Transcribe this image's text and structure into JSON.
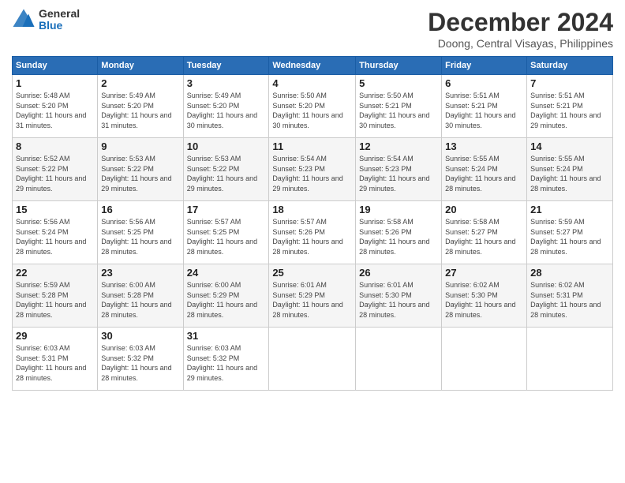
{
  "logo": {
    "general": "General",
    "blue": "Blue"
  },
  "title": "December 2024",
  "subtitle": "Doong, Central Visayas, Philippines",
  "days_header": [
    "Sunday",
    "Monday",
    "Tuesday",
    "Wednesday",
    "Thursday",
    "Friday",
    "Saturday"
  ],
  "weeks": [
    [
      {
        "day": "1",
        "sunrise": "5:48 AM",
        "sunset": "5:20 PM",
        "daylight": "11 hours and 31 minutes."
      },
      {
        "day": "2",
        "sunrise": "5:49 AM",
        "sunset": "5:20 PM",
        "daylight": "11 hours and 31 minutes."
      },
      {
        "day": "3",
        "sunrise": "5:49 AM",
        "sunset": "5:20 PM",
        "daylight": "11 hours and 30 minutes."
      },
      {
        "day": "4",
        "sunrise": "5:50 AM",
        "sunset": "5:20 PM",
        "daylight": "11 hours and 30 minutes."
      },
      {
        "day": "5",
        "sunrise": "5:50 AM",
        "sunset": "5:21 PM",
        "daylight": "11 hours and 30 minutes."
      },
      {
        "day": "6",
        "sunrise": "5:51 AM",
        "sunset": "5:21 PM",
        "daylight": "11 hours and 30 minutes."
      },
      {
        "day": "7",
        "sunrise": "5:51 AM",
        "sunset": "5:21 PM",
        "daylight": "11 hours and 29 minutes."
      }
    ],
    [
      {
        "day": "8",
        "sunrise": "5:52 AM",
        "sunset": "5:22 PM",
        "daylight": "11 hours and 29 minutes."
      },
      {
        "day": "9",
        "sunrise": "5:53 AM",
        "sunset": "5:22 PM",
        "daylight": "11 hours and 29 minutes."
      },
      {
        "day": "10",
        "sunrise": "5:53 AM",
        "sunset": "5:22 PM",
        "daylight": "11 hours and 29 minutes."
      },
      {
        "day": "11",
        "sunrise": "5:54 AM",
        "sunset": "5:23 PM",
        "daylight": "11 hours and 29 minutes."
      },
      {
        "day": "12",
        "sunrise": "5:54 AM",
        "sunset": "5:23 PM",
        "daylight": "11 hours and 29 minutes."
      },
      {
        "day": "13",
        "sunrise": "5:55 AM",
        "sunset": "5:24 PM",
        "daylight": "11 hours and 28 minutes."
      },
      {
        "day": "14",
        "sunrise": "5:55 AM",
        "sunset": "5:24 PM",
        "daylight": "11 hours and 28 minutes."
      }
    ],
    [
      {
        "day": "15",
        "sunrise": "5:56 AM",
        "sunset": "5:24 PM",
        "daylight": "11 hours and 28 minutes."
      },
      {
        "day": "16",
        "sunrise": "5:56 AM",
        "sunset": "5:25 PM",
        "daylight": "11 hours and 28 minutes."
      },
      {
        "day": "17",
        "sunrise": "5:57 AM",
        "sunset": "5:25 PM",
        "daylight": "11 hours and 28 minutes."
      },
      {
        "day": "18",
        "sunrise": "5:57 AM",
        "sunset": "5:26 PM",
        "daylight": "11 hours and 28 minutes."
      },
      {
        "day": "19",
        "sunrise": "5:58 AM",
        "sunset": "5:26 PM",
        "daylight": "11 hours and 28 minutes."
      },
      {
        "day": "20",
        "sunrise": "5:58 AM",
        "sunset": "5:27 PM",
        "daylight": "11 hours and 28 minutes."
      },
      {
        "day": "21",
        "sunrise": "5:59 AM",
        "sunset": "5:27 PM",
        "daylight": "11 hours and 28 minutes."
      }
    ],
    [
      {
        "day": "22",
        "sunrise": "5:59 AM",
        "sunset": "5:28 PM",
        "daylight": "11 hours and 28 minutes."
      },
      {
        "day": "23",
        "sunrise": "6:00 AM",
        "sunset": "5:28 PM",
        "daylight": "11 hours and 28 minutes."
      },
      {
        "day": "24",
        "sunrise": "6:00 AM",
        "sunset": "5:29 PM",
        "daylight": "11 hours and 28 minutes."
      },
      {
        "day": "25",
        "sunrise": "6:01 AM",
        "sunset": "5:29 PM",
        "daylight": "11 hours and 28 minutes."
      },
      {
        "day": "26",
        "sunrise": "6:01 AM",
        "sunset": "5:30 PM",
        "daylight": "11 hours and 28 minutes."
      },
      {
        "day": "27",
        "sunrise": "6:02 AM",
        "sunset": "5:30 PM",
        "daylight": "11 hours and 28 minutes."
      },
      {
        "day": "28",
        "sunrise": "6:02 AM",
        "sunset": "5:31 PM",
        "daylight": "11 hours and 28 minutes."
      }
    ],
    [
      {
        "day": "29",
        "sunrise": "6:03 AM",
        "sunset": "5:31 PM",
        "daylight": "11 hours and 28 minutes."
      },
      {
        "day": "30",
        "sunrise": "6:03 AM",
        "sunset": "5:32 PM",
        "daylight": "11 hours and 28 minutes."
      },
      {
        "day": "31",
        "sunrise": "6:03 AM",
        "sunset": "5:32 PM",
        "daylight": "11 hours and 29 minutes."
      },
      null,
      null,
      null,
      null
    ]
  ]
}
